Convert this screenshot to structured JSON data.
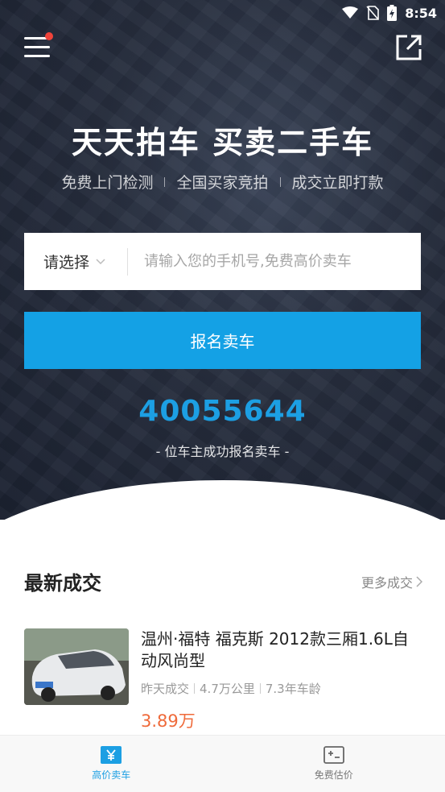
{
  "status_bar": {
    "time": "8:54"
  },
  "hero": {
    "title": "天天拍车  买卖二手车",
    "features": [
      "免费上门检测",
      "全国买家竞拍",
      "成交立即打款"
    ],
    "count": "40055644",
    "count_caption": "- 位车主成功报名卖车 -"
  },
  "form": {
    "city_label": "请选择",
    "phone_placeholder": "请输入您的手机号,免费高价卖车",
    "submit_label": "报名卖车"
  },
  "latest": {
    "title": "最新成交",
    "more_label": "更多成交",
    "items": [
      {
        "title": "温州·福特 福克斯 2012款三厢1.6L自动风尚型",
        "deal_time": "昨天成交",
        "mileage": "4.7万公里",
        "age": "7.3年车龄",
        "price": "3.89万"
      }
    ]
  },
  "bottom_nav": {
    "items": [
      {
        "label": "高价卖车",
        "icon": "yen-card-icon"
      },
      {
        "label": "免费估价",
        "icon": "estimate-card-icon"
      }
    ]
  },
  "colors": {
    "accent": "#14a1e5",
    "count_blue": "#1c9fe3",
    "price_orange": "#ef6a3a",
    "badge_red": "#f0433a"
  }
}
